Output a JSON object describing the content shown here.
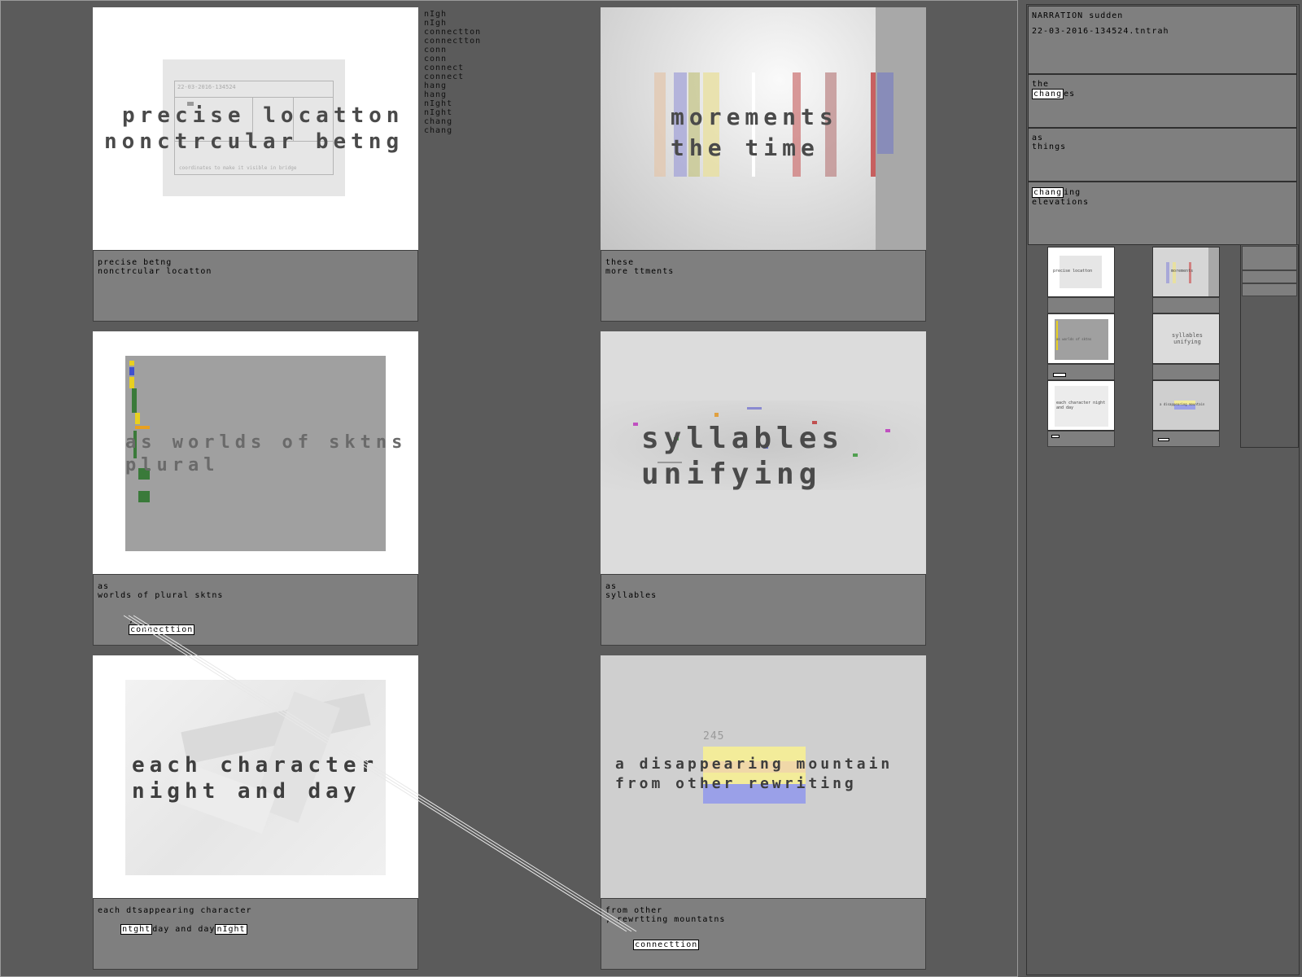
{
  "panels": [
    {
      "overlay_lines": [
        "precise locatton",
        "nonctrcular betng"
      ],
      "screen_text": "22-03-2016-134524",
      "screen_subtext": "coordinates to make it visible in bridge",
      "caption": [
        "precise betng",
        "nonctrcular locatton"
      ]
    },
    {
      "overlay_lines": [
        "morements",
        "the time"
      ],
      "caption": [
        "these",
        "more ttments"
      ]
    },
    {
      "overlay_lines": [
        "as worlds of sktns",
        "plural"
      ],
      "caption": [
        "as",
        "worlds of plural sktns"
      ],
      "tag_prefix": ",",
      "tag": "connecttion"
    },
    {
      "overlay_lines": [
        "syllables",
        "unifying"
      ],
      "caption": [
        "as",
        "syllables"
      ]
    },
    {
      "overlay_lines": [
        "each character",
        "night and day"
      ],
      "caption_line1": "each dtsappearing character",
      "caption_tag1": "ntght",
      "caption_mid": "day and day",
      "caption_tag2": "nIght"
    },
    {
      "overlay_number": "245",
      "overlay_lines": [
        "a disappearing mountain",
        "from other rewriting"
      ],
      "caption": [
        "from other",
        ", rewrtting mountatns"
      ],
      "tag": "connecttion"
    }
  ],
  "word_list": [
    "nIgh",
    "nIgh",
    "connectton",
    "connectton",
    "conn",
    "conn",
    "connect",
    "connect",
    "hang",
    "hang",
    "nIght",
    "nIght",
    "chang",
    "chang"
  ],
  "sidebar": {
    "title": "NARRATION sudden",
    "filename": "22-03-2016-134524.tntrah",
    "blocks": [
      {
        "lines": [
          "the"
        ],
        "tag": "chang",
        "tag_suffix": "es"
      },
      {
        "lines": [
          "as",
          "things"
        ]
      },
      {
        "tag": "chang",
        "tag_suffix": "ing",
        "lines2": [
          "elevations"
        ]
      }
    ]
  },
  "thumbnails": [
    {
      "overlay": "precise locatton"
    },
    {
      "overlay": "morements"
    },
    {
      "overlay": "as worlds of sktns"
    },
    {
      "overlay": "syllables unifying"
    },
    {
      "overlay": "each character night and day"
    },
    {
      "overlay": "a disappearing mountain"
    }
  ]
}
